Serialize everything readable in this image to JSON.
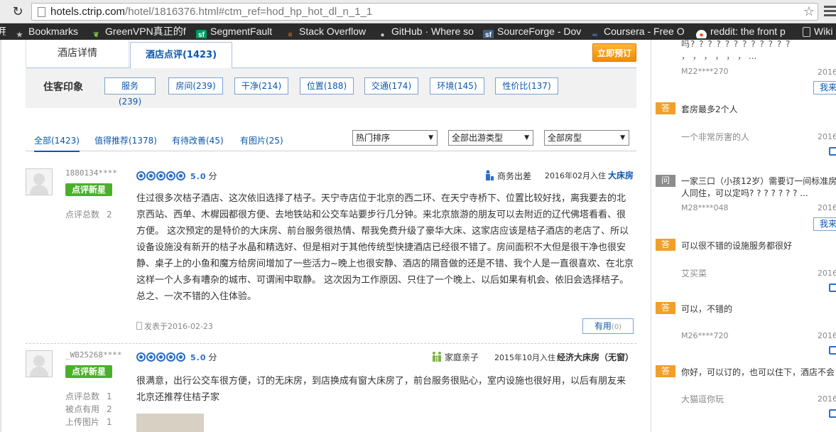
{
  "browser": {
    "url_host": "hotels.ctrip.com",
    "url_rest": "/hotel/1816376.html#ctm_ref=hod_hp_hot_dl_n_1_1",
    "left_edge_text": "用",
    "bookmarks": [
      {
        "label": "Bookmarks",
        "icon": "star-icon"
      },
      {
        "label": "GreenVPN真正的f",
        "icon": "greenvpn-icon"
      },
      {
        "label": "SegmentFault",
        "icon": "sf-icon"
      },
      {
        "label": "Stack Overflow",
        "icon": "stackoverflow-icon"
      },
      {
        "label": "GitHub · Where so",
        "icon": "github-icon"
      },
      {
        "label": "SourceForge - Dov",
        "icon": "sourceforge-icon"
      },
      {
        "label": "Coursera - Free O",
        "icon": "coursera-icon"
      },
      {
        "label": "reddit: the front p",
        "icon": "reddit-icon"
      },
      {
        "label": "Wiki",
        "icon": "page-icon"
      }
    ]
  },
  "hotel_tabs": {
    "details": "酒店详情",
    "reviews": "酒店点评(1423)",
    "book": "立即预订"
  },
  "impression": {
    "title": "住客印象",
    "tags": [
      "服务(239)",
      "房间(239)",
      "干净(214)",
      "位置(188)",
      "交通(174)",
      "环境(145)",
      "性价比(137)"
    ]
  },
  "filters": {
    "tabs": [
      "全部(1423)",
      "值得推荐(1378)",
      "有待改善(45)",
      "有图片(25)"
    ],
    "selects": [
      "热门排序",
      "全部出游类型",
      "全部房型"
    ]
  },
  "reviews": [
    {
      "user": "1880134****",
      "badge": "点评新星",
      "stats": [
        {
          "label": "点评总数",
          "value": "2"
        }
      ],
      "score": "5.0",
      "score_unit": "分",
      "trip_type": "商务出差",
      "checkin": "2016年02月入住",
      "room": "大床房",
      "text": "住过很多次桔子酒店、这次依旧选择了桔子。天宁寺店位于北京的西二环、在天宁寺桥下、位置比较好找，离我要去的北京西站、西单、木樨园都很方便、去地铁站和公交车站要步行几分钟。来北京旅游的朋友可以去附近的辽代佛塔看看、很方便。 这次预定的是特价的大床房、前台服务很热情、帮我免费升级了豪华大床、这家店应该是桔子酒店的老店了、所以设备设施没有新开的桔子水晶和精选好、但是相对于其他传统型快捷酒店已经很不错了。房间面积不大但是很干净也很安静、桌子上的小鱼和魔方给房间增加了一些活力~晚上也很安静、酒店的隔音做的还是不错、我个人是一直很喜欢、在北京这样一个人多有嘈杂的城市、可谓闹中取静。 这次因为工作原因、只住了一个晚上、以后如果有机会、依旧会选择桔子。总之、一次不错的入住体验。",
      "posted": "发表于2016-02-23",
      "useful": "有用",
      "useful_count": "(0)"
    },
    {
      "user": "_WB25268****",
      "badge": "点评新星",
      "stats": [
        {
          "label": "点评总数",
          "value": "1"
        },
        {
          "label": "被点有用",
          "value": "2"
        },
        {
          "label": "上传图片",
          "value": "1"
        }
      ],
      "score": "5.0",
      "score_unit": "分",
      "trip_type": "家庭亲子",
      "checkin": "2015年10月入住",
      "room": "经济大床房（无窗）",
      "text": "很满意，出行公交车很方便，订的无床房，到店换成有窗大床房了，前台服务很贴心，室内设施也很好用，以后有朋友来北京还推荐住桔子家"
    }
  ],
  "qa": {
    "items": [
      {
        "type": "top",
        "text": "吗? ? ? ? ? ? ? ? ? ? ? ?",
        "text2": "， ， ， ， ， ， ...",
        "user": "M22****270",
        "date": "2016-",
        "btn": "我来"
      },
      {
        "type": "answer",
        "badge": "答",
        "text": "套房最多2个人",
        "user": "一个非常厉害的人",
        "date": "2016-"
      },
      {
        "type": "question",
        "badge": "问",
        "text": "一家三口（小孩12岁）需要订一间标准房",
        "text2": "人同住，可以定吗? ? ? ? ? ? ? ...",
        "user": "M28****048",
        "date": "2016-",
        "btn": "我来"
      },
      {
        "type": "answer",
        "badge": "答",
        "text": "可以很不错的设施服务都很好",
        "user": "艾买菜",
        "date": "2016-"
      },
      {
        "type": "answer",
        "badge": "答",
        "text": "可以，不错的",
        "user": "M26****720",
        "date": "2016-"
      },
      {
        "type": "answer",
        "badge": "答",
        "text": "你好，可以订的，也可以住下，酒店不会",
        "user": "大猫逗你玩",
        "date": "2016-"
      }
    ]
  },
  "colors": {
    "link": "#0a57ad",
    "badge_green": "#4caf2c",
    "answer_orange": "#f0a02a",
    "book_orange": "#f08c00"
  }
}
